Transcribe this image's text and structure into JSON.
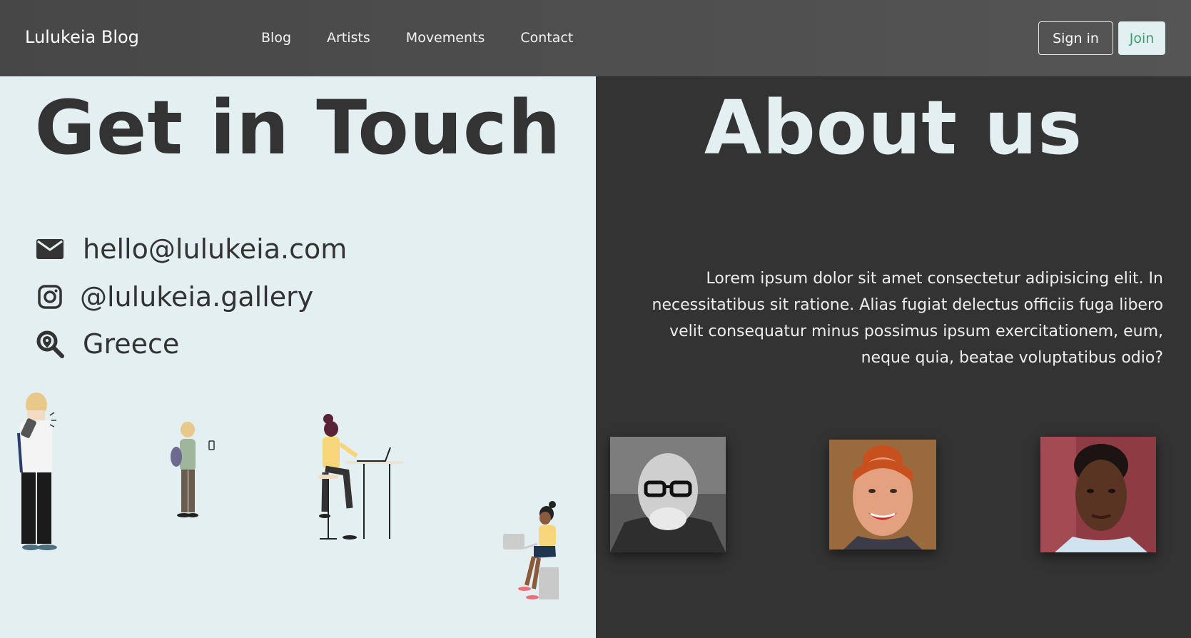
{
  "nav": {
    "brand": "Lulukeia Blog",
    "links": [
      "Blog",
      "Artists",
      "Movements",
      "Contact"
    ],
    "signin_label": "Sign in",
    "join_label": "Join"
  },
  "contact": {
    "heading": "Get in Touch",
    "email": "hello@lulukeia.com",
    "instagram": "@lulukeia.gallery",
    "location": "Greece"
  },
  "about": {
    "heading": "About us",
    "text": "Lorem ipsum dolor sit amet consectetur adipisicing elit. In necessitatibus sit ratione. Alias fugiat delectus officiis fuga libero velit consequatur minus possimus ipsum exercitationem, eum, neque quia, beatae voluptatibus odio?"
  },
  "colors": {
    "nav_bg": "#4f4f4f",
    "left_bg": "#e3eff1",
    "right_bg": "#333333",
    "join_text": "#3a9c6e"
  },
  "icons": [
    "envelope-icon",
    "instagram-icon",
    "location-search-icon"
  ]
}
